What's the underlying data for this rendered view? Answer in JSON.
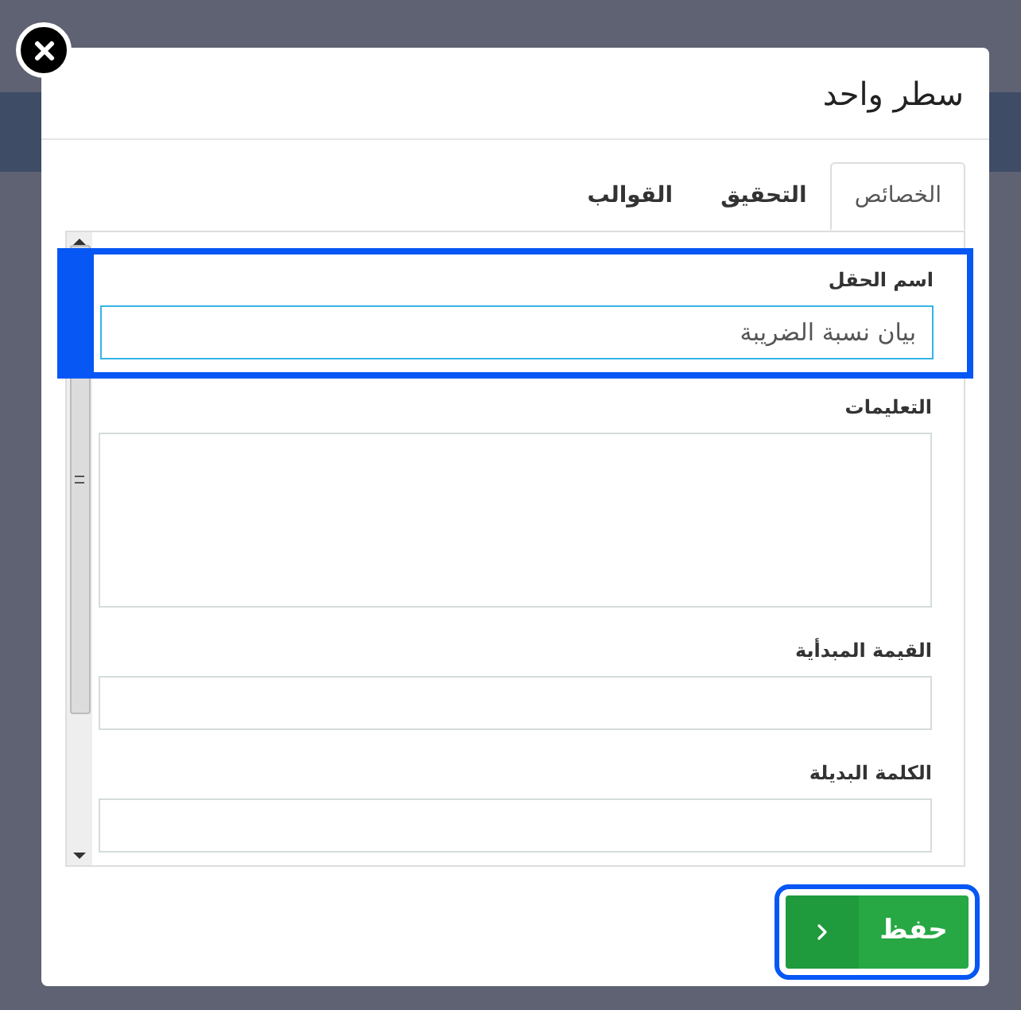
{
  "dialog": {
    "title": "سطر واحد"
  },
  "tabs": [
    {
      "label": "الخصائص",
      "selected": true
    },
    {
      "label": "التحقيق",
      "selected": false
    },
    {
      "label": "القوالب",
      "selected": false
    }
  ],
  "fields": [
    {
      "label": "اسم الحقل",
      "kind": "input",
      "value": "بيان نسبة الضريبة",
      "highlighted": true
    },
    {
      "label": "التعليمات",
      "kind": "textarea",
      "highlighted": false
    },
    {
      "label": "القيمة المبدأية",
      "kind": "input",
      "highlighted": false
    },
    {
      "label": "الكلمة البديلة",
      "kind": "input",
      "highlighted": false
    }
  ],
  "save_button": {
    "label": "حفظ",
    "focused": true
  }
}
